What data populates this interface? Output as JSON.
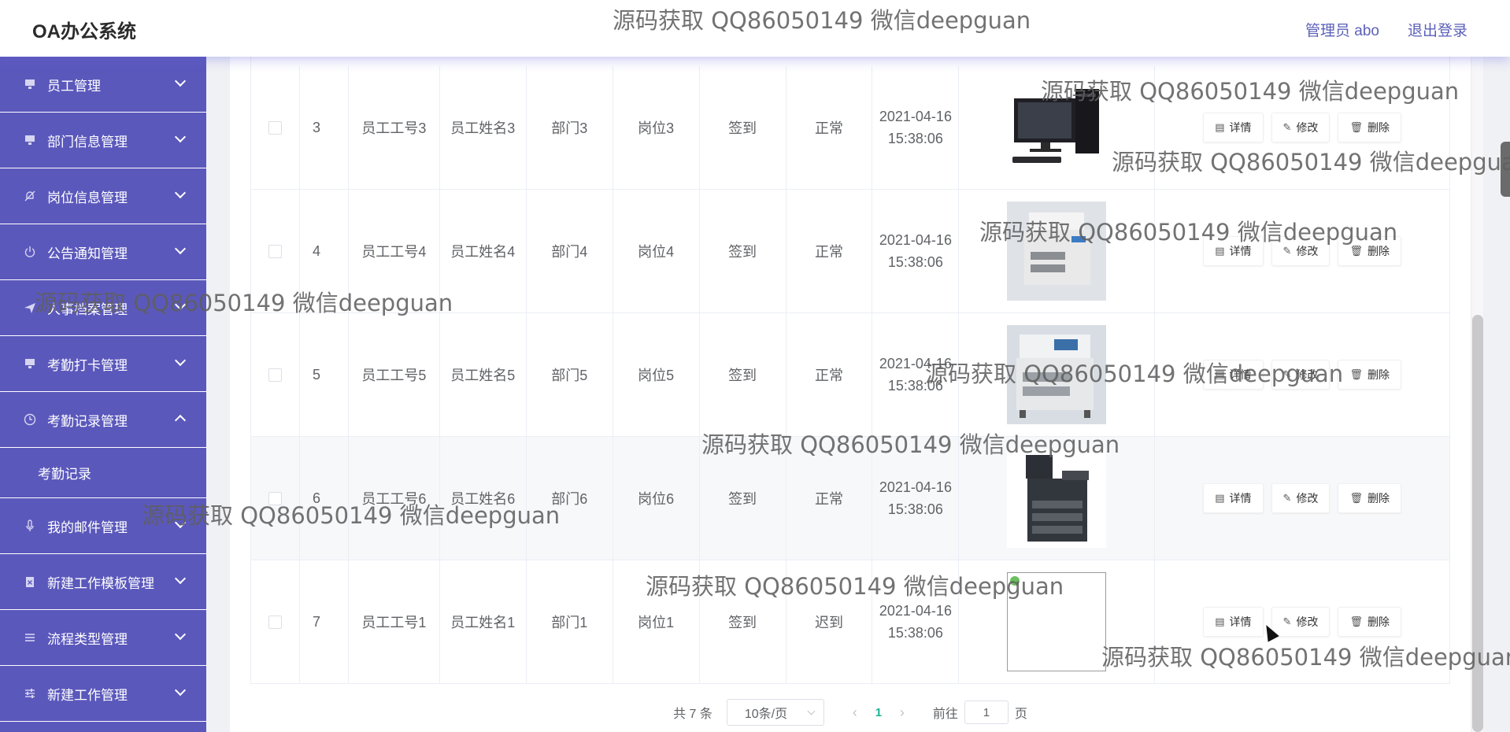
{
  "header": {
    "brand": "OA办公系统",
    "user": "管理员 abo",
    "logout": "退出登录"
  },
  "sidebar": {
    "items": [
      {
        "label": "员工管理",
        "icon": "monitor-icon"
      },
      {
        "label": "部门信息管理",
        "icon": "monitor-icon"
      },
      {
        "label": "岗位信息管理",
        "icon": "bell-off-icon"
      },
      {
        "label": "公告通知管理",
        "icon": "power-icon"
      },
      {
        "label": "人事档案管理",
        "icon": "send-icon"
      },
      {
        "label": "考勤打卡管理",
        "icon": "monitor-icon"
      },
      {
        "label": "考勤记录管理",
        "icon": "clock-icon",
        "expanded": true
      },
      {
        "label": "我的邮件管理",
        "icon": "microphone-icon"
      },
      {
        "label": "新建工作模板管理",
        "icon": "clipboard-icon"
      },
      {
        "label": "流程类型管理",
        "icon": "list-icon"
      },
      {
        "label": "新建工作管理",
        "icon": "sliders-icon"
      }
    ],
    "submenu": {
      "label": "考勤记录"
    }
  },
  "table": {
    "rows": [
      {
        "index": "3",
        "emp_no": "员工工号3",
        "emp_name": "员工姓名3",
        "dept": "部门3",
        "post": "岗位3",
        "type": "签到",
        "status": "正常",
        "time": "2021-04-16 15:38:06",
        "image": "computer"
      },
      {
        "index": "4",
        "emp_no": "员工工号4",
        "emp_name": "员工姓名4",
        "dept": "部门4",
        "post": "岗位4",
        "type": "签到",
        "status": "正常",
        "time": "2021-04-16 15:38:06",
        "image": "printer-a"
      },
      {
        "index": "5",
        "emp_no": "员工工号5",
        "emp_name": "员工姓名5",
        "dept": "部门5",
        "post": "岗位5",
        "type": "签到",
        "status": "正常",
        "time": "2021-04-16 15:38:06",
        "image": "printer-b"
      },
      {
        "index": "6",
        "emp_no": "员工工号6",
        "emp_name": "员工姓名6",
        "dept": "部门6",
        "post": "岗位6",
        "type": "签到",
        "status": "正常",
        "time": "2021-04-16 15:38:06",
        "image": "copier"
      },
      {
        "index": "7",
        "emp_no": "员工工号1",
        "emp_name": "员工姓名1",
        "dept": "部门1",
        "post": "岗位1",
        "type": "签到",
        "status": "迟到",
        "time": "2021-04-16 15:38:06",
        "image": "broken"
      }
    ],
    "actions": {
      "detail": "详情",
      "edit": "修改",
      "delete": "删除"
    }
  },
  "pagination": {
    "total": "共 7 条",
    "page_size": "10条/页",
    "current": "1",
    "goto_prefix": "前往",
    "goto_value": "1",
    "goto_suffix": "页"
  },
  "watermark": "源码获取 QQ86050149 微信deepguan",
  "colors": {
    "sidebar": "#5b58bc",
    "accent": "#1bb394",
    "header_text": "#5b5fb8"
  }
}
